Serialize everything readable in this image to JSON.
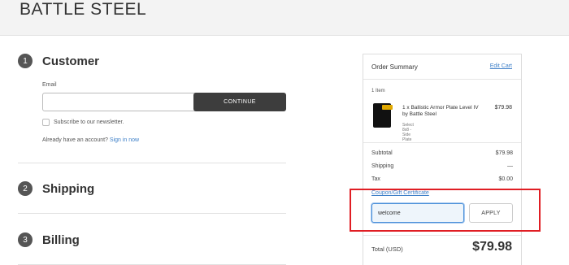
{
  "header": {
    "brand": "BATTLE STEEL"
  },
  "steps": [
    {
      "number": "1",
      "title": "Customer"
    },
    {
      "number": "2",
      "title": "Shipping"
    },
    {
      "number": "3",
      "title": "Billing"
    }
  ],
  "customer": {
    "email_label": "Email",
    "email_value": "",
    "continue_label": "CONTINUE",
    "newsletter_label": "Subscribe to our newsletter.",
    "account_prompt": "Already have an account?",
    "sign_in_label": "Sign in now"
  },
  "summary": {
    "title": "Order Summary",
    "edit_cart": "Edit Cart",
    "items_count": "1 Item",
    "product": {
      "name": "1 x Ballistic Armor Plate Level IV by Battle Steel",
      "variant": "Select 8x8 - Side Plate",
      "price": "$79.98"
    },
    "subtotal_label": "Subtotal",
    "subtotal_value": "$79.98",
    "shipping_label": "Shipping",
    "shipping_value": "—",
    "tax_label": "Tax",
    "tax_value": "$0.00",
    "coupon_label": "Coupon/Gift Certificate",
    "coupon_value": "welcome",
    "apply_label": "APPLY",
    "total_label": "Total (USD)",
    "total_value": "$79.98"
  },
  "colors": {
    "link": "#3f80c8",
    "button_dark": "#3d3d3d",
    "highlight": "#e01e24"
  }
}
